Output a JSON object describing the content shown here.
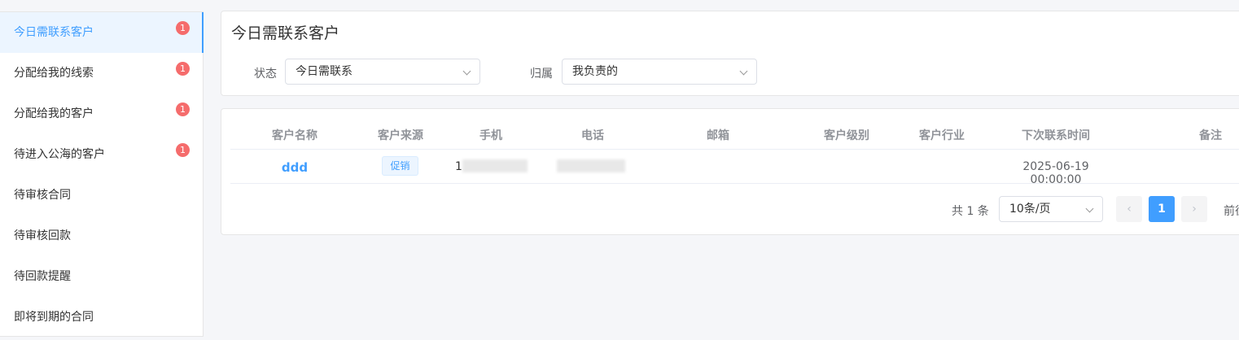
{
  "sidebar": {
    "items": [
      {
        "label": "今日需联系客户",
        "badge": "1"
      },
      {
        "label": "分配给我的线索",
        "badge": "1"
      },
      {
        "label": "分配给我的客户",
        "badge": "1"
      },
      {
        "label": "待进入公海的客户",
        "badge": "1"
      },
      {
        "label": "待审核合同",
        "badge": ""
      },
      {
        "label": "待审核回款",
        "badge": ""
      },
      {
        "label": "待回款提醒",
        "badge": ""
      },
      {
        "label": "即将到期的合同",
        "badge": ""
      }
    ]
  },
  "filter": {
    "title": "今日需联系客户",
    "status_label": "状态",
    "status_value": "今日需联系",
    "owner_label": "归属",
    "owner_value": "我负责的"
  },
  "table": {
    "headers": [
      "客户名称",
      "客户来源",
      "手机",
      "电话",
      "邮箱",
      "客户级别",
      "客户行业",
      "下次联系时间",
      "备注"
    ],
    "rows": [
      {
        "name": "ddd",
        "source": "促销",
        "mobile_prefix": "1",
        "next_contact": "2025-06-19 00:00:00"
      }
    ]
  },
  "pagination": {
    "total": "共 1 条",
    "page_size": "10条/页",
    "prev": "‹",
    "current": "1",
    "next": "›",
    "jumper": "前往"
  },
  "colors": {
    "accent": "#409eff",
    "badge": "#f56c6c"
  }
}
